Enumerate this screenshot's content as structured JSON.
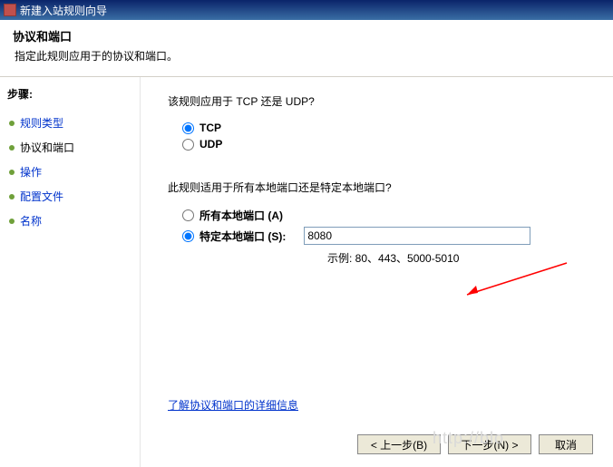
{
  "titlebar": {
    "title": "新建入站规则向导"
  },
  "header": {
    "title": "协议和端口",
    "desc": "指定此规则应用于的协议和端口。"
  },
  "sidebar": {
    "label": "步骤:",
    "items": [
      {
        "label": "规则类型"
      },
      {
        "label": "协议和端口"
      },
      {
        "label": "操作"
      },
      {
        "label": "配置文件"
      },
      {
        "label": "名称"
      }
    ]
  },
  "main": {
    "q1": "该规则应用于 TCP 还是 UDP?",
    "tcp": "TCP",
    "udp": "UDP",
    "q2": "此规则适用于所有本地端口还是特定本地端口?",
    "allPorts": "所有本地端口 (A)",
    "specPorts": "特定本地端口 (S):",
    "portValue": "8080",
    "example": "示例: 80、443、5000-5010",
    "detailLink": "了解协议和端口的详细信息"
  },
  "buttons": {
    "back": "< 上一步(B)",
    "next": "下一步(N) >",
    "cancel": "取消"
  },
  "watermark": "http://blo"
}
